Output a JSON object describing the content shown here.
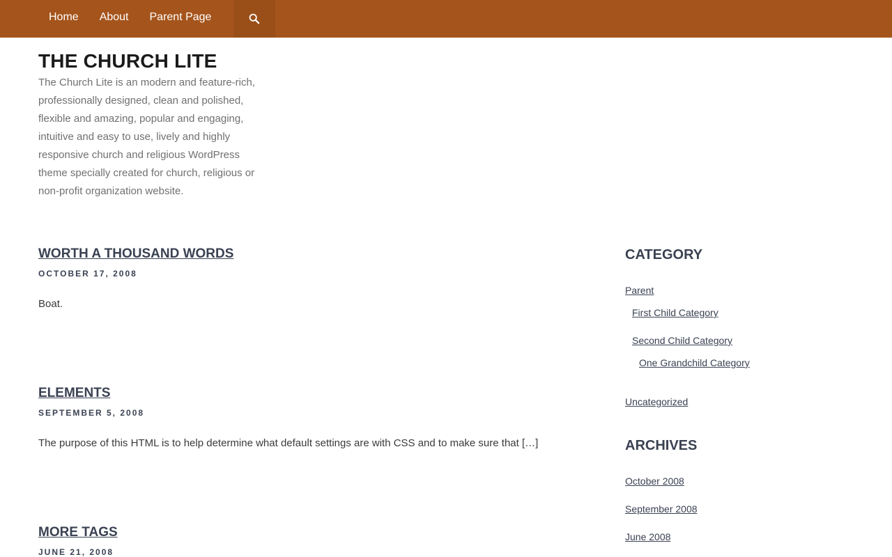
{
  "nav": {
    "items": [
      {
        "label": "Home"
      },
      {
        "label": "About"
      },
      {
        "label": "Parent Page"
      }
    ]
  },
  "site": {
    "title": "THE CHURCH LITE",
    "description": "The Church Lite is an modern and feature-rich, professionally designed, clean and polished, flexible and amazing, popular and engaging, intuitive and easy to use, lively and highly responsive church and religious WordPress theme specially created for church, religious or non-profit organization website."
  },
  "posts": [
    {
      "title": "WORTH A THOUSAND WORDS",
      "date": "OCTOBER 17, 2008",
      "excerpt": "Boat."
    },
    {
      "title": "ELEMENTS",
      "date": "SEPTEMBER 5, 2008",
      "excerpt": "The purpose of this HTML is to help determine what default settings are with CSS and to make sure that […]"
    },
    {
      "title": "MORE TAGS",
      "date": "JUNE 21, 2008",
      "excerpt": ""
    }
  ],
  "sidebar": {
    "category_title": "CATEGORY",
    "categories": [
      {
        "label": "Parent"
      },
      {
        "label": "First Child Category"
      },
      {
        "label": "Second Child Category"
      },
      {
        "label": "One Grandchild Category"
      },
      {
        "label": "Uncategorized"
      }
    ],
    "archives_title": "ARCHIVES",
    "archives": [
      {
        "label": "October 2008"
      },
      {
        "label": "September 2008"
      },
      {
        "label": "June 2008"
      }
    ]
  },
  "colors": {
    "topbar": "#a5541b",
    "heading": "#3a4152"
  },
  "icons": {
    "search": "search-icon"
  }
}
